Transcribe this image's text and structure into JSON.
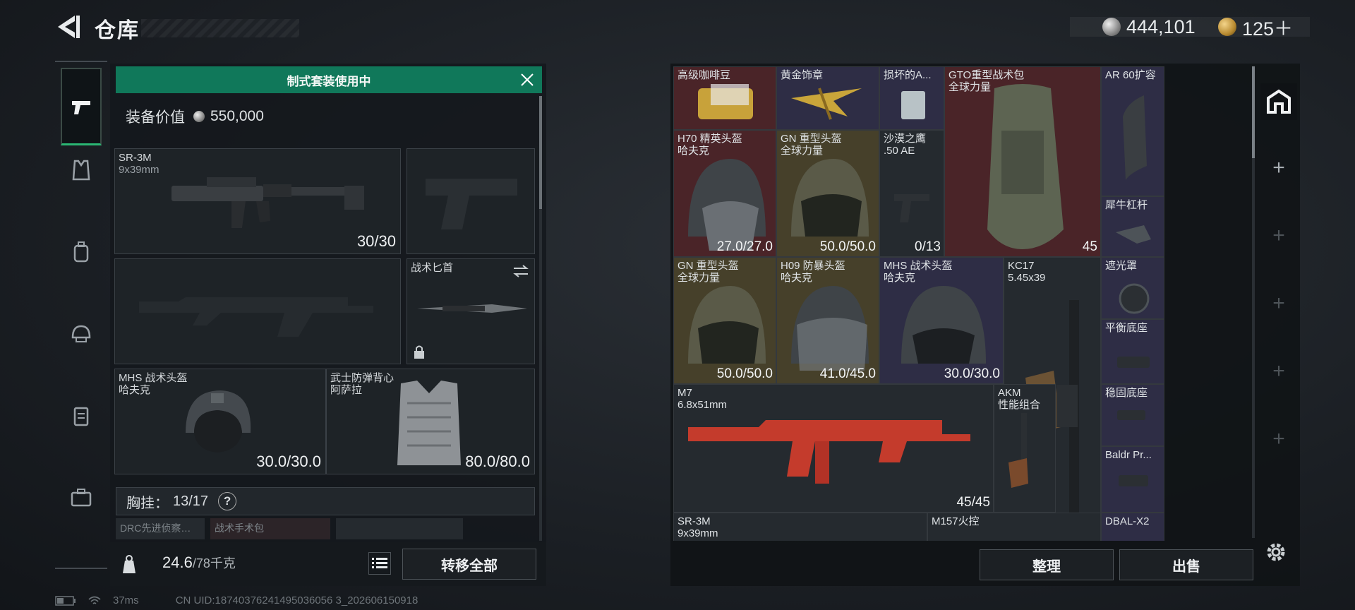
{
  "header": {
    "title": "仓库"
  },
  "currency": {
    "silver": "444,101",
    "gold": "125＋"
  },
  "loadout": {
    "banner": "制式套装使用中",
    "value_label": "装备价值",
    "value": "550,000",
    "slots": {
      "primary": {
        "name": "SR-3M",
        "sub": "9x39mm",
        "value": "30/30"
      },
      "knife": {
        "name": "战术匕首"
      },
      "helmet": {
        "name": "MHS 战术头盔",
        "sub": "哈夫克",
        "value": "30.0/30.0"
      },
      "armor": {
        "name": "武士防弹背心",
        "sub": "阿萨拉",
        "value": "80.0/80.0"
      }
    },
    "chest": {
      "label": "胸挂：",
      "value": "13/17",
      "help": "?"
    },
    "sub_slots": [
      "DRC先进侦察…",
      "战术手术包",
      ""
    ],
    "weight": {
      "current": "24.6",
      "max": "/78千克"
    },
    "transfer_all": "转移全部"
  },
  "stash": {
    "items": [
      {
        "id": "coffee",
        "name": "高级咖啡豆",
        "sub": "",
        "value": "",
        "color": "red"
      },
      {
        "id": "badge",
        "name": "黄金饰章",
        "sub": "",
        "value": "",
        "color": "purple"
      },
      {
        "id": "broken",
        "name": "损坏的A...",
        "sub": "",
        "value": "",
        "color": "purple"
      },
      {
        "id": "gto",
        "name": "GTO重型战术包",
        "sub": "全球力量",
        "value": "45",
        "color": "red"
      },
      {
        "id": "ar60",
        "name": "AR 60扩容",
        "sub": "",
        "value": "",
        "color": "purple"
      },
      {
        "id": "h70",
        "name": "H70 精英头盔",
        "sub": "哈夫克",
        "value": "27.0/27.0",
        "color": "red"
      },
      {
        "id": "gn1",
        "name": "GN 重型头盔",
        "sub": "全球力量",
        "value": "50.0/50.0",
        "color": "gold"
      },
      {
        "id": "deagle",
        "name": "沙漠之鹰",
        "sub": ".50 AE",
        "value": "0/13",
        "color": "grey"
      },
      {
        "id": "crowbar",
        "name": "犀牛杠杆",
        "sub": "",
        "value": "",
        "color": "purple"
      },
      {
        "id": "gn2",
        "name": "GN 重型头盔",
        "sub": "全球力量",
        "value": "50.0/50.0",
        "color": "gold"
      },
      {
        "id": "h09",
        "name": "H09 防暴头盔",
        "sub": "哈夫克",
        "value": "41.0/45.0",
        "color": "gold"
      },
      {
        "id": "mhs",
        "name": "MHS 战术头盔",
        "sub": "哈夫克",
        "value": "30.0/30.0",
        "color": "purple"
      },
      {
        "id": "kc17",
        "name": "KC17",
        "sub": "5.45x39",
        "value": "",
        "color": "grey"
      },
      {
        "id": "shade",
        "name": "遮光罩",
        "sub": "",
        "value": "",
        "color": "purple"
      },
      {
        "id": "balance",
        "name": "平衡底座",
        "sub": "",
        "value": "",
        "color": "purple"
      },
      {
        "id": "m7",
        "name": "M7",
        "sub": "6.8x51mm",
        "value": "45/45",
        "color": "grey"
      },
      {
        "id": "akm",
        "name": "AKM",
        "sub": "性能组合",
        "value": "",
        "color": "grey"
      },
      {
        "id": "stable",
        "name": "稳固底座",
        "sub": "",
        "value": "",
        "color": "purple"
      },
      {
        "id": "baldr",
        "name": "Baldr Pr...",
        "sub": "",
        "value": "",
        "color": "purple"
      },
      {
        "id": "sr3m",
        "name": "SR-3M",
        "sub": "9x39mm",
        "value": "",
        "color": "grey"
      },
      {
        "id": "m157",
        "name": "M157火控",
        "sub": "",
        "value": "",
        "color": "grey"
      },
      {
        "id": "dbal",
        "name": "DBAL-X2",
        "sub": "",
        "value": "",
        "color": "purple"
      }
    ],
    "organize": "整理",
    "sell": "出售"
  },
  "status": {
    "ping": "37ms",
    "uid": "CN UID:18740376241495036056 3_202606150918"
  }
}
